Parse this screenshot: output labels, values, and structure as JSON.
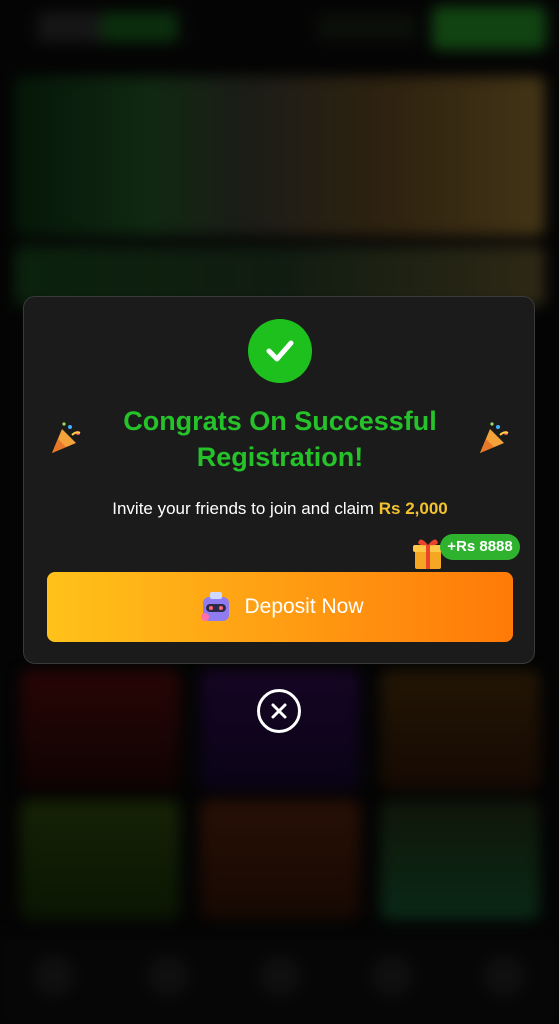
{
  "modal": {
    "title": "Congrats On Successful Registration!",
    "invite_text": "Invite your friends to join and claim",
    "invite_amount": "Rs 2,000",
    "bonus_badge": "+Rs 8888",
    "deposit_label": "Deposit Now"
  },
  "icons": {
    "success": "check-circle-icon",
    "left_decor": "party-popper-icon",
    "right_decor": "party-popper-icon",
    "gift": "gift-box-icon",
    "deposit": "robot-wallet-icon",
    "close": "close-circle-icon"
  },
  "colors": {
    "title": "#25c22a",
    "accent_gold": "#f2c230",
    "button_start": "#ffc21a",
    "button_end": "#ff7a08",
    "badge": "#2fb32f",
    "modal_bg": "#1b1b1b"
  }
}
